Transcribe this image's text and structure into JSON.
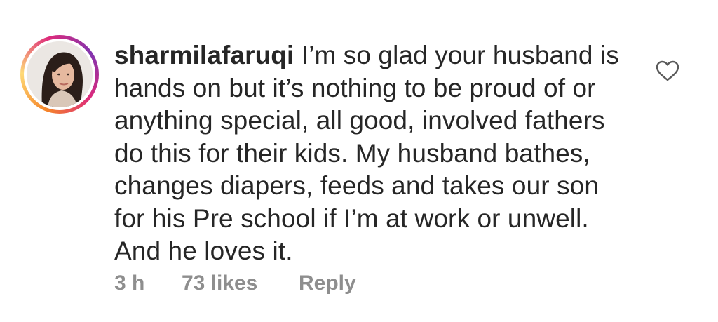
{
  "comment": {
    "username": "sharmilafaruqi",
    "lines": [
      "I’m so glad your husband is",
      "hands on but it’s nothing to be proud of or",
      "anything special, all good, involved fathers",
      "do this for their kids. My husband bathes,",
      "changes diapers, feeds and takes our son",
      "for his Pre school if I’m at work or unwell.",
      "And he loves it."
    ],
    "time": "3 h",
    "likes": "73 likes",
    "reply_label": "Reply",
    "like_icon": "heart-outline-icon"
  },
  "colors": {
    "text": "#262626",
    "meta": "#8e8e8e",
    "story_ring_start": "#f58529",
    "story_ring_end": "#dd2a7b"
  }
}
